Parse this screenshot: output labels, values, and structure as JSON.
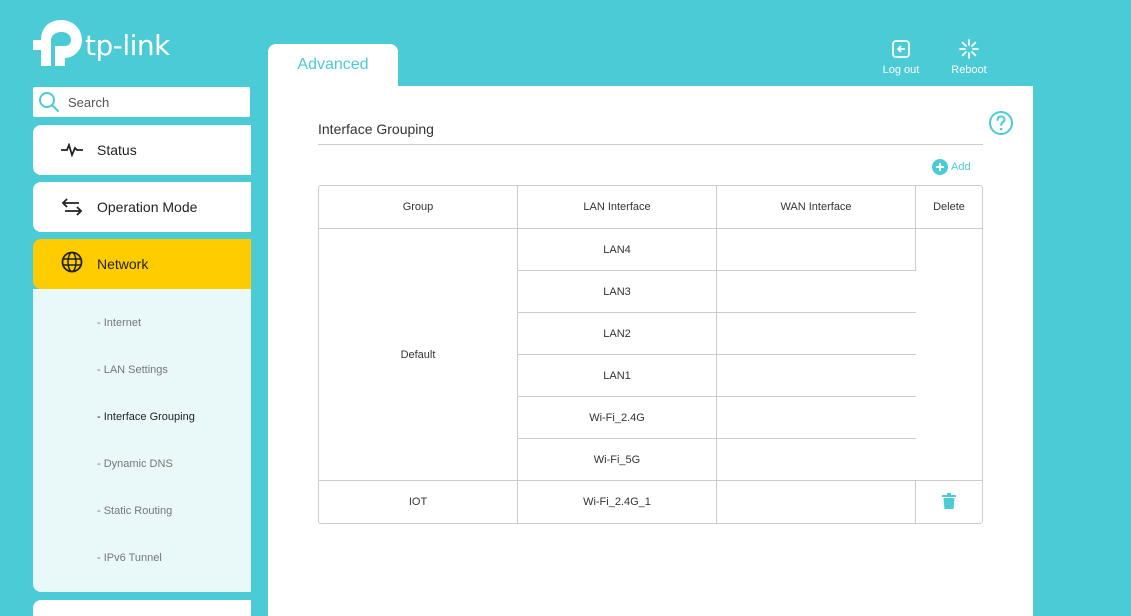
{
  "brand": {
    "name": "tp-link"
  },
  "search": {
    "placeholder": "Search"
  },
  "sidebar": {
    "items": [
      {
        "label": "Status",
        "icon": "pulse-icon"
      },
      {
        "label": "Operation Mode",
        "icon": "swap-arrows-icon"
      },
      {
        "label": "Network",
        "icon": "globe-icon",
        "active": true
      }
    ],
    "network_sub": [
      {
        "label": "- Internet"
      },
      {
        "label": "- LAN Settings"
      },
      {
        "label": "- Interface Grouping",
        "active": true
      },
      {
        "label": "- Dynamic DNS"
      },
      {
        "label": "- Static Routing"
      },
      {
        "label": "- IPv6 Tunnel"
      }
    ]
  },
  "tabs": {
    "advanced": "Advanced"
  },
  "header": {
    "logout": "Log out",
    "reboot": "Reboot"
  },
  "main": {
    "title": "Interface Grouping",
    "add_label": "Add",
    "table": {
      "headers": [
        "Group",
        "LAN Interface",
        "WAN Interface",
        "Delete"
      ],
      "groups": [
        {
          "name": "Default",
          "lan": [
            "LAN4",
            "LAN3",
            "LAN2",
            "LAN1",
            "Wi-Fi_2.4G",
            "Wi-Fi_5G"
          ],
          "wan": ""
        },
        {
          "name": "IOT",
          "lan": [
            "Wi-Fi_2.4G_1"
          ],
          "wan": ""
        }
      ]
    }
  },
  "colors": {
    "accent": "#4acbd6",
    "active": "#ffcc00",
    "subnav_bg": "#e9f8f9"
  }
}
